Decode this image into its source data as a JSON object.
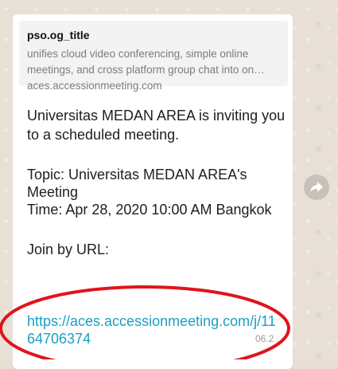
{
  "preview": {
    "title": "pso.og_title",
    "description_lines": [
      "unifies cloud video conferencing, simple online",
      "meetings, and cross platform group chat into on…"
    ],
    "domain": "aces.accessionmeeting.com"
  },
  "message": {
    "lines": [
      "Universitas MEDAN AREA is inviting you",
      "to a scheduled meeting.",
      "Topic: Universitas MEDAN AREA's",
      "Meeting",
      "Time: Apr 28, 2020 10:00 AM Bangkok",
      "Join by URL:"
    ],
    "link_lines": [
      "https://aces.accessionmeeting.com/j/11",
      "64706374"
    ],
    "timestamp": "06.2"
  },
  "icons": {
    "forward": "forward-arrow-icon"
  },
  "colors": {
    "link": "#1ba0c4",
    "annotation": "#e0141c",
    "bubble": "#ffffff",
    "chat_background": "#e8e0d6"
  }
}
